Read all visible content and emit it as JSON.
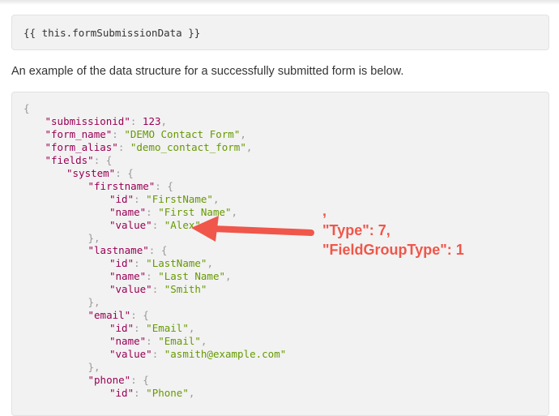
{
  "template_code": "{{ this.formSubmissionData }}",
  "intro": "An example of the data structure for a successfully submitted form is below.",
  "json_lines": [
    [
      [
        "p",
        "{"
      ]
    ],
    [
      [
        "k",
        "\"submissionid\""
      ],
      [
        "p",
        ": "
      ],
      [
        "n",
        "123"
      ],
      [
        "p",
        ","
      ]
    ],
    [
      [
        "k",
        "\"form_name\""
      ],
      [
        "p",
        ": "
      ],
      [
        "s",
        "\"DEMO Contact Form\""
      ],
      [
        "p",
        ","
      ]
    ],
    [
      [
        "k",
        "\"form_alias\""
      ],
      [
        "p",
        ": "
      ],
      [
        "s",
        "\"demo_contact_form\""
      ],
      [
        "p",
        ","
      ]
    ],
    [
      [
        "k",
        "\"fields\""
      ],
      [
        "p",
        ": {"
      ]
    ],
    [
      [
        "k",
        "\"system\""
      ],
      [
        "p",
        ": {"
      ]
    ],
    [
      [
        "k",
        "\"firstname\""
      ],
      [
        "p",
        ": {"
      ]
    ],
    [
      [
        "k",
        "\"id\""
      ],
      [
        "p",
        ": "
      ],
      [
        "s",
        "\"FirstName\""
      ],
      [
        "p",
        ","
      ]
    ],
    [
      [
        "k",
        "\"name\""
      ],
      [
        "p",
        ": "
      ],
      [
        "s",
        "\"First Name\""
      ],
      [
        "p",
        ","
      ]
    ],
    [
      [
        "k",
        "\"value\""
      ],
      [
        "p",
        ": "
      ],
      [
        "s",
        "\"Alex\""
      ]
    ],
    [
      [
        "p",
        "},"
      ]
    ],
    [
      [
        "k",
        "\"lastname\""
      ],
      [
        "p",
        ": {"
      ]
    ],
    [
      [
        "k",
        "\"id\""
      ],
      [
        "p",
        ": "
      ],
      [
        "s",
        "\"LastName\""
      ],
      [
        "p",
        ","
      ]
    ],
    [
      [
        "k",
        "\"name\""
      ],
      [
        "p",
        ": "
      ],
      [
        "s",
        "\"Last Name\""
      ],
      [
        "p",
        ","
      ]
    ],
    [
      [
        "k",
        "\"value\""
      ],
      [
        "p",
        ": "
      ],
      [
        "s",
        "\"Smith\""
      ]
    ],
    [
      [
        "p",
        "},"
      ]
    ],
    [
      [
        "k",
        "\"email\""
      ],
      [
        "p",
        ": {"
      ]
    ],
    [
      [
        "k",
        "\"id\""
      ],
      [
        "p",
        ": "
      ],
      [
        "s",
        "\"Email\""
      ],
      [
        "p",
        ","
      ]
    ],
    [
      [
        "k",
        "\"name\""
      ],
      [
        "p",
        ": "
      ],
      [
        "s",
        "\"Email\""
      ],
      [
        "p",
        ","
      ]
    ],
    [
      [
        "k",
        "\"value\""
      ],
      [
        "p",
        ": "
      ],
      [
        "s",
        "\"asmith@example.com\""
      ]
    ],
    [
      [
        "p",
        "},"
      ]
    ],
    [
      [
        "k",
        "\"phone\""
      ],
      [
        "p",
        ": {"
      ]
    ],
    [
      [
        "k",
        "\"id\""
      ],
      [
        "p",
        ": "
      ],
      [
        "s",
        "\"Phone\""
      ],
      [
        "p",
        ","
      ]
    ]
  ],
  "annotation": {
    "line1": ",",
    "line2": "\"Type\": 7,",
    "line3": "\"FieldGroupType\": 1",
    "color": "#f0564a"
  }
}
